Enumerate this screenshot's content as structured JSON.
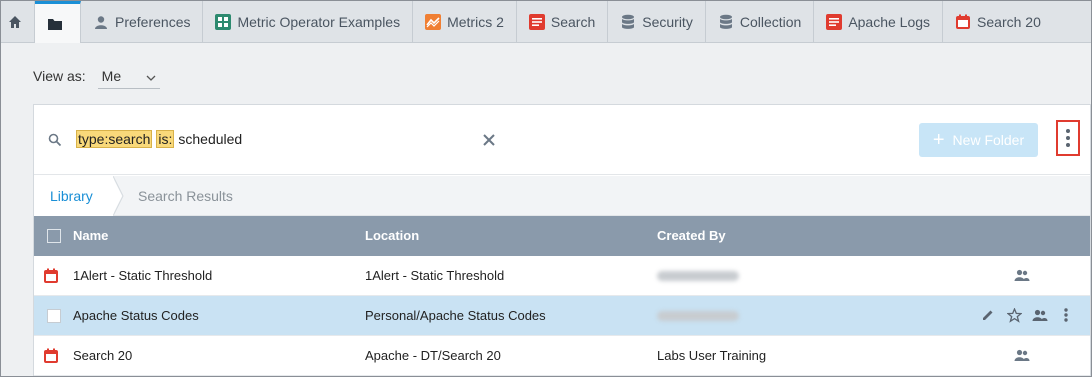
{
  "tabs": [
    {
      "label": "",
      "icon": "home-icon"
    },
    {
      "label": "",
      "icon": "folder-icon"
    },
    {
      "label": "Preferences",
      "icon": "user-icon"
    },
    {
      "label": "Metric Operator Examples",
      "icon": "dashboard-icon"
    },
    {
      "label": "Metrics 2",
      "icon": "metrics-icon"
    },
    {
      "label": "Search",
      "icon": "search-doc-icon"
    },
    {
      "label": "Security",
      "icon": "database-icon"
    },
    {
      "label": "Collection",
      "icon": "database-icon"
    },
    {
      "label": "Apache Logs",
      "icon": "search-doc-icon"
    },
    {
      "label": "Search 20",
      "icon": "calendar-icon"
    }
  ],
  "view_as": {
    "label": "View as:",
    "value": "Me"
  },
  "search": {
    "tokens": [
      "type:search",
      "is:"
    ],
    "rest": "scheduled",
    "new_folder_label": "New Folder"
  },
  "crumbs": {
    "library": "Library",
    "results": "Search Results"
  },
  "table": {
    "columns": [
      "Name",
      "Location",
      "Created By"
    ],
    "rows": [
      {
        "name": "1Alert - Static Threshold",
        "location": "1Alert - Static Threshold",
        "created_by": ""
      },
      {
        "name": "Apache Status Codes",
        "location": "Personal/Apache Status Codes",
        "created_by": ""
      },
      {
        "name": "Search 20",
        "location": "Apache - DT/Search 20",
        "created_by": "Labs User Training"
      }
    ]
  },
  "colors": {
    "accent": "#1a8fd6",
    "highlight": "#f9d97a",
    "header": "#8a9aab",
    "selected_row": "#c9e2f3",
    "danger": "#e03b2f"
  }
}
